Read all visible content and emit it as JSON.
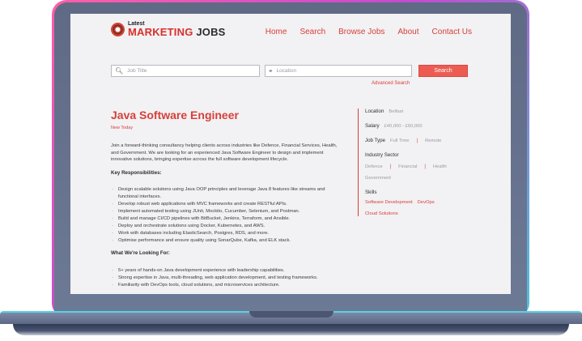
{
  "site": {
    "logo_small": "Latest",
    "logo_marketing": "MARKETING",
    "logo_jobs": "JOBS"
  },
  "nav": [
    {
      "label": "Home"
    },
    {
      "label": "Search"
    },
    {
      "label": "Browse Jobs"
    },
    {
      "label": "About"
    },
    {
      "label": "Contact Us"
    }
  ],
  "search": {
    "job_title_placeholder": "Job Title",
    "location_placeholder": "Location",
    "button_label": "Search",
    "advanced_label": "Advanced Search"
  },
  "job": {
    "title": "Java Software Engineer",
    "badge": "New Today",
    "intro": "Join a forward-thinking consultancy helping clients across industries like Defence, Financial Services, Health, and Government. We are looking for an experienced Java Software Engineer to design and implement innovative solutions, bringing expertise across the full software development lifecycle.",
    "responsibilities_heading": "Key Responsibilities:",
    "responsibilities": [
      "Design scalable solutions using Java OOP principles and leverage Java 8 features like streams and functional interfaces.",
      "Develop robust web applications with MVC frameworks and create RESTful APIs.",
      "Implement automated testing using JUnit, Mockito, Cucumber, Selenium, and Postman.",
      "Build and manage CI/CD pipelines with BitBucket, Jenkins, Terraform, and Ansible.",
      "Deploy and orchestrate solutions using Docker, Kubernetes, and AWS.",
      "Work with databases including ElasticSearch, Postgres, RDS, and more.",
      "Optimise performance and ensure quality using SonarQube, Kafka, and ELK stack."
    ],
    "looking_heading": "What We're Looking For:",
    "looking": [
      "5+ years of hands-on Java development experience with leadership capabilities.",
      "Strong expertise in Java, multi-threading, web application development, and testing frameworks.",
      "Familiarity with DevOps tools, cloud solutions, and microservices architecture."
    ]
  },
  "sidebar": {
    "location_label": "Location",
    "location_value": "Belfast",
    "salary_label": "Salary",
    "salary_value": "£40,000 - £60,000",
    "job_type_label": "Job Type",
    "job_types": [
      "Full Time",
      "Remote"
    ],
    "industry_label": "Industry Sector",
    "industries": [
      "Defence",
      "Financial",
      "Health"
    ],
    "industry_extra": "Government",
    "skills_label": "Skills",
    "skills": [
      "Software Development",
      "DevOps"
    ],
    "skills_extra": "Cloud Solutions"
  }
}
